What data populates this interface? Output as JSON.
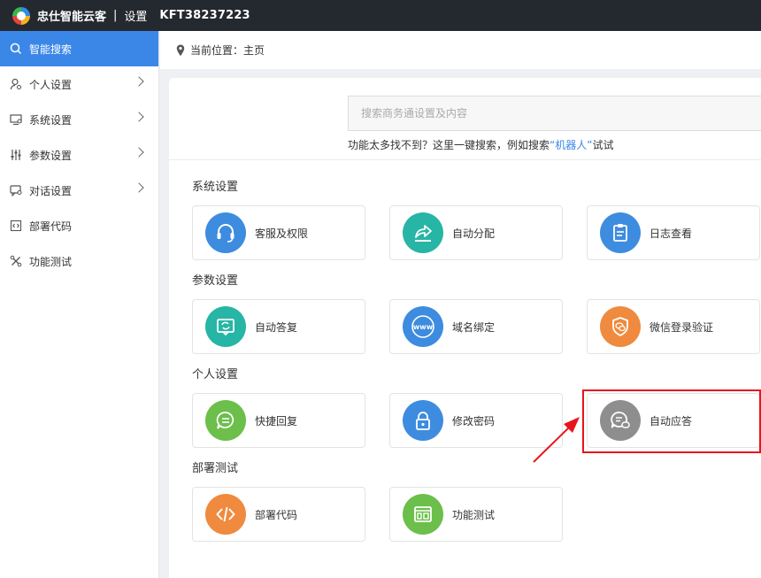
{
  "topbar": {
    "app_name": "忠仕智能云客",
    "separator": "|",
    "settings_label": "设置",
    "account_id": "KFT38237223"
  },
  "sidebar": {
    "items": [
      {
        "label": "智能搜索",
        "icon": "search-icon",
        "active": true
      },
      {
        "label": "个人设置",
        "icon": "user-icon",
        "has_children": true
      },
      {
        "label": "系统设置",
        "icon": "monitor-icon",
        "has_children": true
      },
      {
        "label": "参数设置",
        "icon": "sliders-icon",
        "has_children": true
      },
      {
        "label": "对话设置",
        "icon": "chat-icon",
        "has_children": true
      },
      {
        "label": "部署代码",
        "icon": "code-icon"
      },
      {
        "label": "功能测试",
        "icon": "tools-icon"
      }
    ]
  },
  "breadcrumb": {
    "prefix": "当前位置：",
    "current": "主页"
  },
  "search": {
    "placeholder": "搜索商务通设置及内容",
    "hint_pre": "功能太多找不到？这里一键搜索，例如搜索",
    "hint_keyword": "“机器人”",
    "hint_post": "试试"
  },
  "sections": [
    {
      "title": "系统设置",
      "cards": [
        {
          "label": "客服及权限",
          "icon": "headset-icon",
          "color": "#3d8cdf"
        },
        {
          "label": "自动分配",
          "icon": "share-icon",
          "color": "#27b5a5"
        },
        {
          "label": "日志查看",
          "icon": "clipboard-icon",
          "color": "#3d8cdf"
        }
      ]
    },
    {
      "title": "参数设置",
      "cards": [
        {
          "label": "自动答复",
          "icon": "auto-reply-icon",
          "color": "#27b5a5"
        },
        {
          "label": "域名绑定",
          "icon": "www-icon",
          "color": "#3d8cdf"
        },
        {
          "label": "微信登录验证",
          "icon": "shield-wechat-icon",
          "color": "#ef8a3e"
        }
      ]
    },
    {
      "title": "个人设置",
      "cards": [
        {
          "label": "快捷回复",
          "icon": "quick-reply-icon",
          "color": "#6cbf4a"
        },
        {
          "label": "修改密码",
          "icon": "lock-icon",
          "color": "#3d8cdf"
        },
        {
          "label": "自动应答",
          "icon": "auto-answer-icon",
          "color": "#8e8e8e"
        }
      ]
    },
    {
      "title": "部署测试",
      "cards": [
        {
          "label": "部署代码",
          "icon": "code-icon",
          "color": "#ef8a3e"
        },
        {
          "label": "功能测试",
          "icon": "layout-icon",
          "color": "#6cbf4a"
        }
      ]
    }
  ],
  "colors": {
    "accent": "#3b87e8",
    "highlight": "#e8141c",
    "topbar": "#24282f"
  }
}
